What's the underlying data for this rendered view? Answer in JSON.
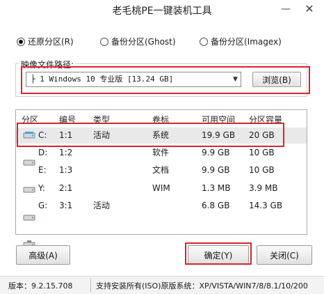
{
  "window": {
    "title": "老毛桃PE一键装机工具",
    "minimize_glyph": "—",
    "close_glyph": "✕"
  },
  "modes": [
    {
      "label": "还原分区(R)",
      "selected": true
    },
    {
      "label": "备份分区(Ghost)",
      "selected": false
    },
    {
      "label": "备份分区(Imagex)",
      "selected": false
    }
  ],
  "image": {
    "label": "映像文件路径:",
    "selected": "├ 1 Windows 10 专业版 [13.24 GB]",
    "browse_label": "浏览(B)"
  },
  "table": {
    "headers": [
      "分区",
      "编号",
      "类型",
      "卷标",
      "可用空间",
      "分区容量"
    ],
    "rows": [
      {
        "drive": "C:",
        "num": "1:1",
        "type": "活动",
        "label": "系统",
        "free": "19.9 GB",
        "size": "20 GB",
        "selected": true
      },
      {
        "drive": "D:",
        "num": "1:2",
        "type": "",
        "label": "软件",
        "free": "9.9 GB",
        "size": "10 GB",
        "selected": false
      },
      {
        "drive": "E:",
        "num": "1:3",
        "type": "",
        "label": "文档",
        "free": "9.9 GB",
        "size": "10 GB",
        "selected": false
      },
      {
        "drive": "Y:",
        "num": "2:1",
        "type": "",
        "label": "WIM",
        "free": "1.3 MB",
        "size": "3.9 MB",
        "selected": false
      },
      {
        "drive": "G:",
        "num": "3:1",
        "type": "活动",
        "label": "",
        "free": "6.8 GB",
        "size": "14.3 GB",
        "selected": false
      }
    ]
  },
  "buttons": {
    "advanced": "高级(A)",
    "ok": "确定(Y)",
    "close": "关闭(C)"
  },
  "status": {
    "version": "版本：9.2.15.708",
    "support": "支持安装所有(ISO)原版系统：XP/VISTA/WIN7/8/8.1/10/200"
  },
  "colors": {
    "highlight": "#d9232a",
    "selected_row": "#e9e9e9"
  }
}
